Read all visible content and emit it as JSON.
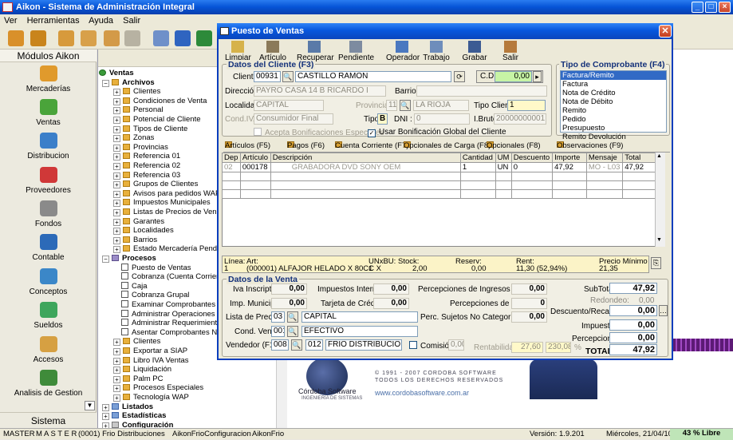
{
  "window": {
    "title": "Aikon - Sistema de Administración Integral"
  },
  "menu": [
    "Ver",
    "Herramientas",
    "Ayuda",
    "Salir"
  ],
  "left_panel": {
    "title": "Módulos Aikon",
    "footer": "Sistema",
    "modules": [
      "Mercaderías",
      "Ventas",
      "Distribucion",
      "Proveedores",
      "Fondos",
      "Contable",
      "Conceptos",
      "Sueldos",
      "Accesos",
      "Analisis de Gestion"
    ]
  },
  "tree": {
    "root": "Ventas",
    "archivos": {
      "label": "Archivos",
      "items": [
        "Clientes",
        "Condiciones de Venta",
        "Personal",
        "Potencial de Cliente",
        "Tipos de Cliente",
        "Zonas",
        "Provincias",
        "Referencia 01",
        "Referencia 02",
        "Referencia 03",
        "Grupos de Clientes",
        "Avisos para pedidos WAP",
        "Impuestos Municipales",
        "Listas de Precios de Vendedor",
        "Garantes",
        "Localidades",
        "Barrios",
        "Estado Mercadería Pendiente"
      ]
    },
    "procesos": {
      "label": "Procesos",
      "items": [
        "Puesto de Ventas",
        "Cobranza (Cuenta Corriente)",
        "Caja",
        "Cobranza Grupal",
        "Examinar Comprobantes",
        "Administrar Operaciones",
        "Administrar Requerimientos de",
        "Asentar Comprobantes No Cor"
      ]
    },
    "other": [
      "Clientes",
      "Exportar a SIAP",
      "Libro IVA Ventas",
      "Liquidación",
      "Palm PC",
      "Procesos Especiales",
      "Tecnología WAP"
    ],
    "listados": "Listados",
    "estadisticas": "Estadísticas",
    "configuracion": "Configuración"
  },
  "status": {
    "user1": "MASTER",
    "user2": "M A S T E R",
    "company": "(0001) Frio Distribuciones",
    "config": "AikonFrioConfiguracion",
    "db": "AikonFrio",
    "version": "Versión: 1.9.201",
    "date": "Miércoles, 21/04/10",
    "free": "43 % Libre"
  },
  "splash": {
    "copyright1": "© 1991 - 2007 CORDOBA SOFTWARE",
    "copyright2": "TODOS LOS DERECHOS RESERVADOS",
    "company": "Córdoba Software",
    "tagline": "INGENIERIA DE SISTEMAS",
    "url": "www.cordobasoftware.com.ar"
  },
  "dialog": {
    "title": "Puesto de Ventas",
    "toolbar": [
      "Limpiar",
      "Artículo",
      "Recuperar",
      "Pendiente",
      "Operador",
      "Trabajo",
      "Grabar",
      "Salir"
    ],
    "cliente": {
      "group": "Datos del Cliente (F3)",
      "cliente_label": "Cliente:",
      "cliente_code": "00931",
      "cliente_name": "CASTILLO RAMON",
      "cd_label": "C.D.",
      "cd_value": "0,00",
      "direccion_label": "Dirección:",
      "direccion": "PAYRO CASA 14 B RICARDO I",
      "barrio_label": "Barrio:",
      "barrio": "",
      "localidad_label": "Localidad:",
      "localidad": "CAPITAL",
      "provincia_label": "Provincia:",
      "provincia_code": "11",
      "provincia": "LA RIOJA",
      "tipo_cliente_label": "Tipo Cliente:",
      "tipo_cliente": "1",
      "cond_iva_label": "Cond.IVA:",
      "cond_iva": "Consumidor Final",
      "tipo_label": "Tipo:",
      "tipo": "B",
      "dni_label": "DNI :",
      "dni": "0",
      "ibrutos_label": "I.Brutos:",
      "ibrutos": "20000000001",
      "acepta_label": "Acepta Bonificaciones Especiales",
      "usar_label": "Usar Bonificación Global del Cliente"
    },
    "tipo_comprobante": {
      "group": "Tipo de Comprobante (F4)",
      "items": [
        "Factura/Remito",
        "Factura",
        "Nota de Crédito",
        "Nota de Débito",
        "Remito",
        "Pedido",
        "Presupuesto",
        "Remito Devolución"
      ]
    },
    "tabs": [
      "Artículos (F5)",
      "Pagos (F6)",
      "Cuenta Corriente (F7)",
      "Opcionales de Carga (F8)",
      "Opcionales (F8)",
      "Observaciones (F9)"
    ],
    "grid": {
      "headers": [
        "Dep",
        "Artículo",
        "Descripción",
        "Cantidad",
        "UM",
        "Descuento",
        "Importe",
        "Mensaje",
        "Total"
      ],
      "row": {
        "dep": "02",
        "articulo": "000178",
        "descripcion": "GRABADORA DVD SONY OEM",
        "cantidad": "1",
        "um": "UN",
        "descuento": "0",
        "importe": "47,92",
        "mensaje": "MO - L03",
        "total": "47,92"
      }
    },
    "info": {
      "linea_label": "Línea:",
      "linea": "1",
      "art_label": "Art:",
      "art": "(000001) ALFAJOR HELADO X 80CC X",
      "unxbu_label": "UNxBU:",
      "unxbu": "1",
      "stock_label": "Stock:",
      "stock": "2,00",
      "reserv_label": "Reserv:",
      "reserv": "0,00",
      "rent_label": "Rent:",
      "rent": "11,30 (52,94%)",
      "precio_label": "Precio Mínimo",
      "precio": "21,35"
    },
    "venta": {
      "group": "Datos de la Venta",
      "iva_insc_label": "Iva Inscripto:",
      "iva_insc": "0,00",
      "imp_int_label": "Impuestos Internos:",
      "imp_int": "0,00",
      "perc_ib_label": "Percepciones de Ingresos Brutos:",
      "perc_ib": "0,00",
      "imp_mun_label": "Imp. Municipal:",
      "imp_mun": "0,00",
      "tarjeta_label": "Tarjeta de Crédito:",
      "tarjeta": "0,00",
      "perc_iva_label": "Percepciones de IVA:",
      "perc_iva": "0",
      "lista_label": "Lista de Precios:",
      "lista_code": "03",
      "lista": "CAPITAL",
      "perc_nc_label": "Perc. Sujetos No Categorizados:",
      "perc_nc": "0,00",
      "cond_label": "Cond. Venta:",
      "cond_code": "001",
      "cond": "EFECTIVO",
      "vend_label": "Vendedor (F12):",
      "vend_code": "008",
      "vend_code2": "012",
      "vend": "FRIO DISTRIBUCIONES",
      "comision_label": "Comisión:",
      "comision": "0,00",
      "rent_label": "Rentabilidad:",
      "rent1": "27,60",
      "rent2": "230,08",
      "pct": "%",
      "subtotal_label": "SubTotal:",
      "subtotal": "47,92",
      "redondeo_label": "Redondeo:",
      "redondeo": "0,00",
      "desc_label": "Descuento/Recargo:",
      "desc": "0,00",
      "impuestos_label": "Impuestos:",
      "impuestos": "0,00",
      "percep_label": "Percepciones:",
      "percep": "0,00",
      "total_label": "TOTAL:",
      "total": "47,92"
    }
  }
}
